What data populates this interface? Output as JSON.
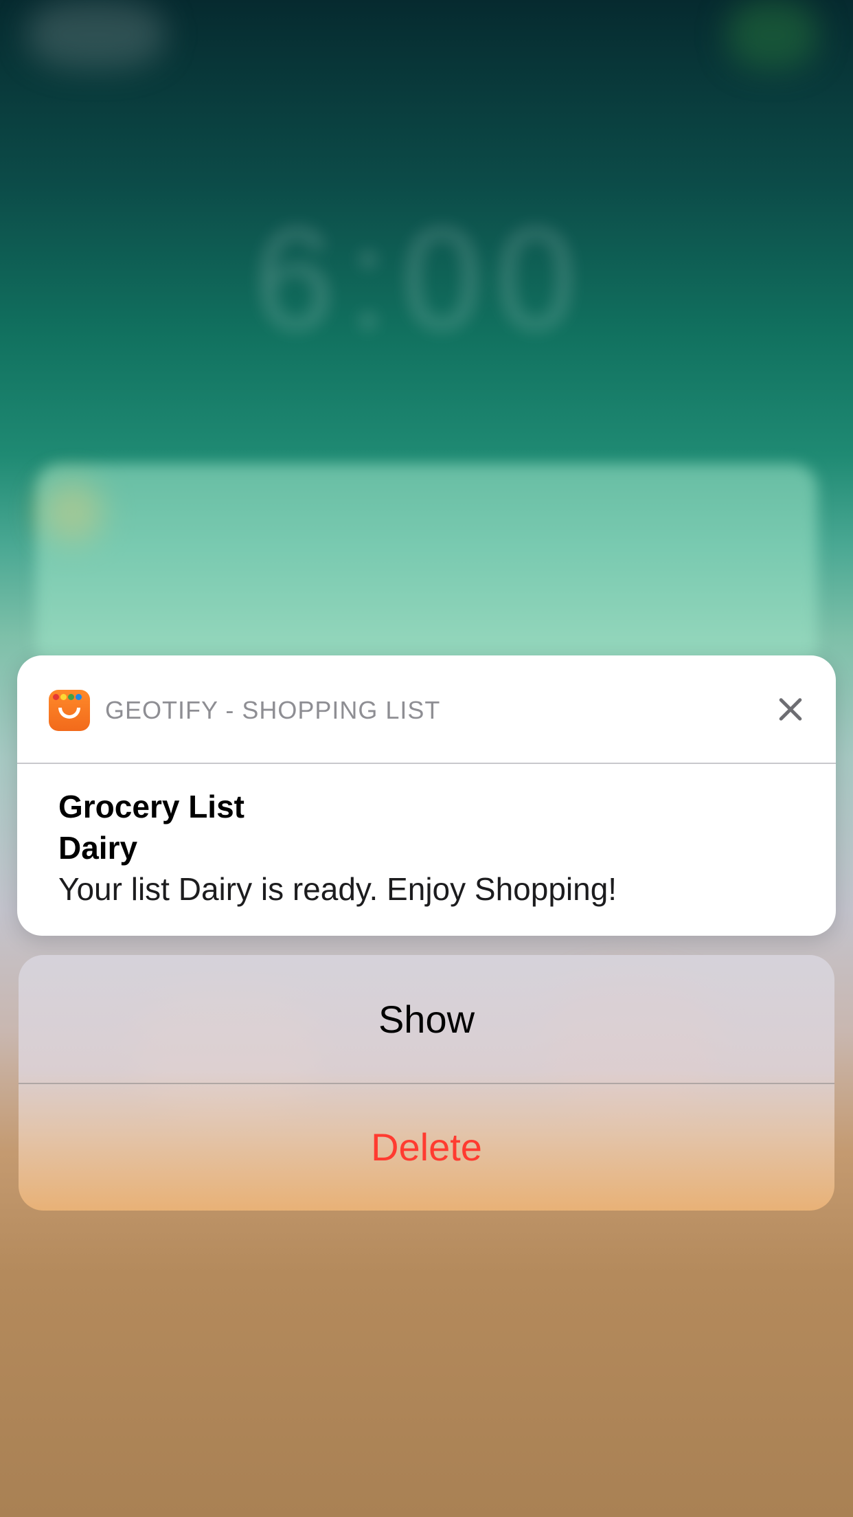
{
  "notification": {
    "app_name": "GEOTIFY - SHOPPING LIST",
    "title": "Grocery List",
    "subtitle": "Dairy",
    "message": "Your list Dairy is ready. Enjoy Shopping!"
  },
  "actions": {
    "show_label": "Show",
    "delete_label": "Delete"
  },
  "colors": {
    "delete": "#ff3b30",
    "app_icon": "#f26a1b"
  },
  "icons": {
    "app": "shopping-bag-icon",
    "close": "close-icon"
  }
}
